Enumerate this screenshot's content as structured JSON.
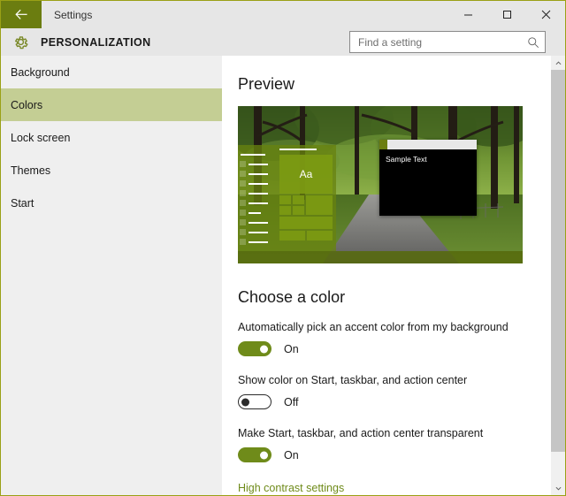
{
  "titlebar": {
    "back_icon": "back-arrow-icon",
    "title": "Settings",
    "minimize_label": "–",
    "maximize_label": "□",
    "close_label": "✕"
  },
  "header": {
    "gear_icon": "gear-icon",
    "title": "PERSONALIZATION"
  },
  "search": {
    "placeholder": "Find a setting",
    "value": "",
    "icon": "search-icon"
  },
  "sidebar": {
    "items": [
      {
        "label": "Background",
        "selected": false
      },
      {
        "label": "Colors",
        "selected": true
      },
      {
        "label": "Lock screen",
        "selected": false
      },
      {
        "label": "Themes",
        "selected": false
      },
      {
        "label": "Start",
        "selected": false
      }
    ]
  },
  "preview": {
    "heading": "Preview",
    "start_tile_text": "Aa",
    "sample_window_text": "Sample Text"
  },
  "choose_color": {
    "heading": "Choose a color",
    "settings": [
      {
        "label": "Automatically pick an accent color from my background",
        "state": "On",
        "on": true
      },
      {
        "label": "Show color on Start, taskbar, and action center",
        "state": "Off",
        "on": false
      },
      {
        "label": "Make Start, taskbar, and action center transparent",
        "state": "On",
        "on": true
      }
    ],
    "link": "High contrast settings"
  },
  "scrollbar": {
    "up_icon": "chevron-up-icon",
    "down_icon": "chevron-down-icon"
  },
  "colors": {
    "accent": "#6b7d10",
    "toggle_on": "#6f8b1a",
    "selected_nav": "#c4ce94",
    "link": "#6f8b1a",
    "titlebar_bg": "#e6e6e6",
    "sidebar_bg": "#efefef"
  }
}
